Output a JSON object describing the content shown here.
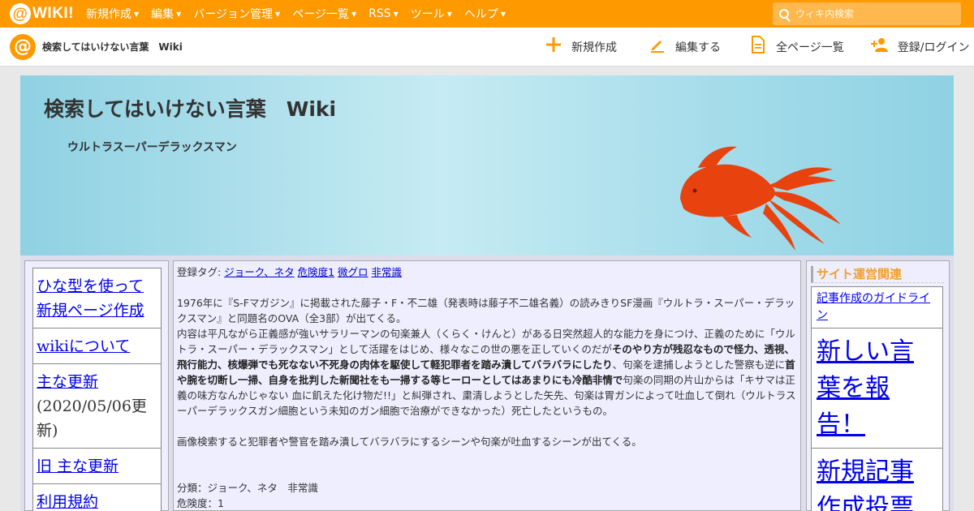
{
  "topbar": {
    "logo_text": "WIKI!",
    "menu": [
      {
        "label": "新規作成"
      },
      {
        "label": "編集"
      },
      {
        "label": "バージョン管理"
      },
      {
        "label": "ページ一覧"
      },
      {
        "label": "RSS"
      },
      {
        "label": "ツール"
      },
      {
        "label": "ヘルプ"
      }
    ],
    "search_placeholder": "ウィキ内検索"
  },
  "subbar": {
    "site_name": "検索してはいけない言葉　Wiki",
    "actions": [
      {
        "label": "新規作成",
        "icon": "plus-icon"
      },
      {
        "label": "編集する",
        "icon": "pencil-icon"
      },
      {
        "label": "全ページ一覧",
        "icon": "page-list-icon"
      },
      {
        "label": "登録/ログイン",
        "icon": "user-add-icon"
      }
    ]
  },
  "banner": {
    "title": "検索してはいけない言葉　Wiki",
    "subtitle": "ウルトラスーパーデラックスマン"
  },
  "left_menu": {
    "items": [
      {
        "label": "ひな型を使って新規ページ作成"
      },
      {
        "label": "wikiについて"
      },
      {
        "label": "主な更新",
        "note": "(2020/05/06更新)"
      },
      {
        "label": "旧 主な更新"
      },
      {
        "label": "利用規約"
      }
    ]
  },
  "article": {
    "tags_label": "登録タグ:",
    "tags": [
      "ジョーク、ネタ",
      "危険度1",
      "微グロ",
      "非常識"
    ],
    "p1": "1976年に『S-Fマガジン』に掲載された藤子・F・不二雄（発表時は藤子不二雄名義）の読みきりSF漫画『ウルトラ・スーパー・デラックスマン』と同題名のOVA（全3部）が出てくる。",
    "p2_a": "内容は平凡ながら正義感が強いサラリーマンの句楽兼人（くらく・けんと）がある日突然超人的な能力を身につけ、正義のために「ウルトラ・スーパー・デラックスマン」として活躍をはじめ、様々なこの世の悪を正していくのだが",
    "p2_b": "そのやり方が残忍なもので怪力、透視、飛行能力、核爆弾でも死なない不死身の肉体を駆使して軽犯罪者を踏み潰してバラバラにしたり",
    "p2_c": "、句楽を逮捕しようとした警察も逆に",
    "p2_d": "首や腕を切断し一掃、自身を批判した新聞社をも一掃する等ヒーローとしてはあまりにも冷酷非情で",
    "p2_e": "句楽の同期の片山からは「キサマは正義の味方なんかじゃない 血に飢えた化け物だ!!」と糾弾され、粛清しようとした矢先、句楽は胃ガンによって吐血して倒れ（ウルトラスーパーデラックスガン細胞という未知のガン細胞で治療ができなかった）死亡したというもの。",
    "p3": "画像検索すると犯罪者や警官を踏み潰してバラバラにするシーンや句楽が吐血するシーンが出てくる。",
    "category": "分類：ジョーク、ネタ　非常識",
    "danger": "危険度：1"
  },
  "right_menu": {
    "heading": "サイト運営関連",
    "items": [
      {
        "label": "記事作成のガイドライン"
      },
      {
        "label": "新しい言葉を報告！"
      },
      {
        "label": "新規記事作成投票"
      }
    ]
  },
  "colors": {
    "accent": "#ff9900",
    "banner_fish": "#e8420f",
    "link": "#0000ee"
  }
}
